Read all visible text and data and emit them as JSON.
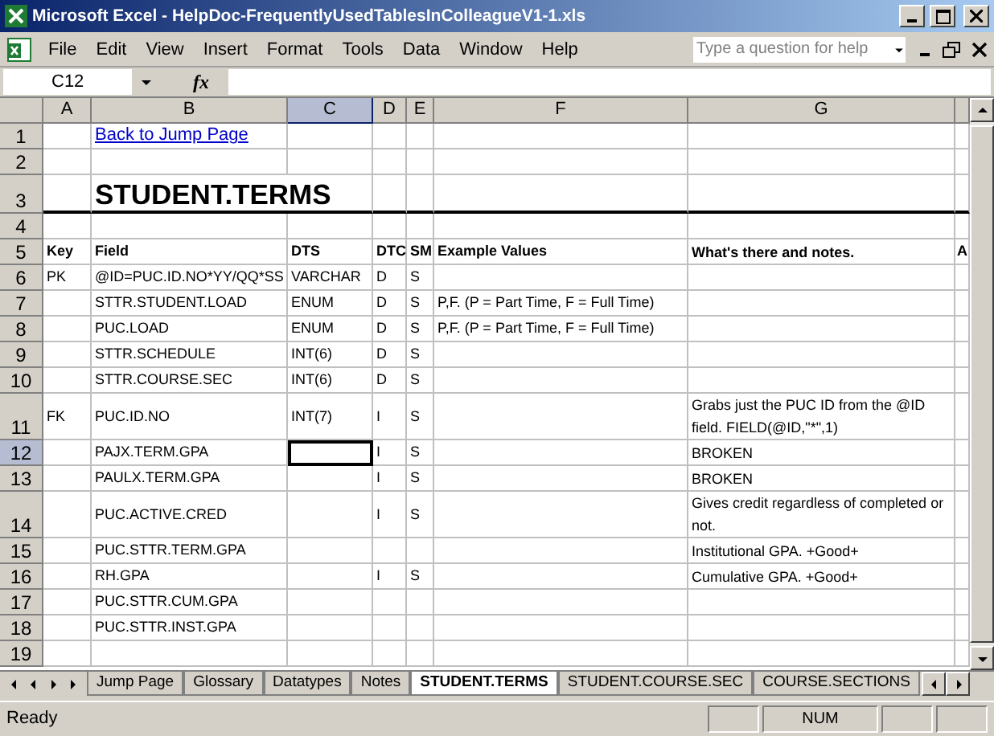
{
  "window": {
    "title": "Microsoft Excel - HelpDoc-FrequentlyUsedTablesInColleagueV1-1.xls"
  },
  "menu": [
    "File",
    "Edit",
    "View",
    "Insert",
    "Format",
    "Tools",
    "Data",
    "Window",
    "Help"
  ],
  "help_box": {
    "placeholder": "Type a question for help"
  },
  "formula_bar": {
    "name_box": "C12",
    "fx": "fx"
  },
  "columns": [
    {
      "label": "A",
      "selected": false
    },
    {
      "label": "B",
      "selected": false
    },
    {
      "label": "C",
      "selected": true
    },
    {
      "label": "D",
      "selected": false
    },
    {
      "label": "E",
      "selected": false
    },
    {
      "label": "F",
      "selected": false
    },
    {
      "label": "G",
      "selected": false
    },
    {
      "selected": false
    }
  ],
  "rows": [
    {
      "label": "1",
      "kind": "link",
      "selected": false,
      "cells": {
        "B": "Back to Jump Page"
      }
    },
    {
      "label": "2",
      "kind": "data",
      "selected": false,
      "cells": {}
    },
    {
      "label": "3",
      "kind": "title",
      "selected": false,
      "cells": {
        "B": "STUDENT.TERMS"
      }
    },
    {
      "label": "4",
      "kind": "data",
      "selected": false,
      "cells": {}
    },
    {
      "label": "5",
      "kind": "header",
      "selected": false,
      "cells": {
        "A": "Key",
        "B": "Field",
        "C": "DTS",
        "D": "DTC",
        "E": "SM",
        "F": "Example Values",
        "G": "What's there and notes.",
        "H": "A"
      }
    },
    {
      "label": "6",
      "kind": "data",
      "selected": false,
      "cells": {
        "A": "PK",
        "B": "@ID=PUC.ID.NO*YY/QQ*SS",
        "C": "VARCHAR",
        "D": "D",
        "E": "S"
      }
    },
    {
      "label": "7",
      "kind": "data",
      "selected": false,
      "cells": {
        "B": "STTR.STUDENT.LOAD",
        "C": "ENUM",
        "D": "D",
        "E": "S",
        "F": "P,F. (P = Part Time, F = Full Time)"
      }
    },
    {
      "label": "8",
      "kind": "data",
      "selected": false,
      "cells": {
        "B": "PUC.LOAD",
        "C": "ENUM",
        "D": "D",
        "E": "S",
        "F": "P,F. (P = Part Time, F = Full Time)"
      }
    },
    {
      "label": "9",
      "kind": "data",
      "selected": false,
      "cells": {
        "B": "STTR.SCHEDULE",
        "C": "INT(6)",
        "D": "D",
        "E": "S"
      }
    },
    {
      "label": "10",
      "kind": "data",
      "selected": false,
      "cells": {
        "B": "STTR.COURSE.SEC",
        "C": "INT(6)",
        "D": "D",
        "E": "S"
      }
    },
    {
      "label": "11",
      "kind": "data",
      "selected": false,
      "cells": {
        "A": "FK",
        "B": "PUC.ID.NO",
        "C": "INT(7)",
        "D": "I",
        "E": "S",
        "G": "Grabs just the PUC ID from the @ID field. FIELD(@ID,\"*\",1)"
      }
    },
    {
      "label": "12",
      "kind": "data",
      "selected": true,
      "cells": {
        "B": "PAJX.TERM.GPA",
        "D": "I",
        "E": "S",
        "G": "BROKEN"
      }
    },
    {
      "label": "13",
      "kind": "data",
      "selected": false,
      "cells": {
        "B": "PAULX.TERM.GPA",
        "D": "I",
        "E": "S",
        "G": "BROKEN"
      }
    },
    {
      "label": "14",
      "kind": "data",
      "selected": false,
      "cells": {
        "B": "PUC.ACTIVE.CRED",
        "D": "I",
        "E": "S",
        "G": "Gives credit regardless of completed or not."
      }
    },
    {
      "label": "15",
      "kind": "data",
      "selected": false,
      "cells": {
        "B": "PUC.STTR.TERM.GPA",
        "G": "Institutional GPA. +Good+"
      }
    },
    {
      "label": "16",
      "kind": "data",
      "selected": false,
      "cells": {
        "B": "RH.GPA",
        "D": "I",
        "E": "S",
        "G": "Cumulative GPA. +Good+"
      }
    },
    {
      "label": "17",
      "kind": "data",
      "selected": false,
      "cells": {
        "B": "PUC.STTR.CUM.GPA"
      }
    },
    {
      "label": "18",
      "kind": "data",
      "selected": false,
      "cells": {
        "B": "PUC.STTR.INST.GPA"
      }
    },
    {
      "label": "19",
      "kind": "data",
      "selected": false,
      "cells": {}
    }
  ],
  "sheet_tabs": [
    {
      "label": "Jump Page",
      "selected": false
    },
    {
      "label": "Glossary",
      "selected": false
    },
    {
      "label": "Datatypes",
      "selected": false
    },
    {
      "label": "Notes",
      "selected": false
    },
    {
      "label": "STUDENT.TERMS",
      "selected": true
    },
    {
      "label": "STUDENT.COURSE.SEC",
      "selected": false
    },
    {
      "label": "COURSE.SECTIONS",
      "selected": false
    }
  ],
  "status_bar": {
    "state": "Ready",
    "indicators": [
      "NUM"
    ]
  }
}
